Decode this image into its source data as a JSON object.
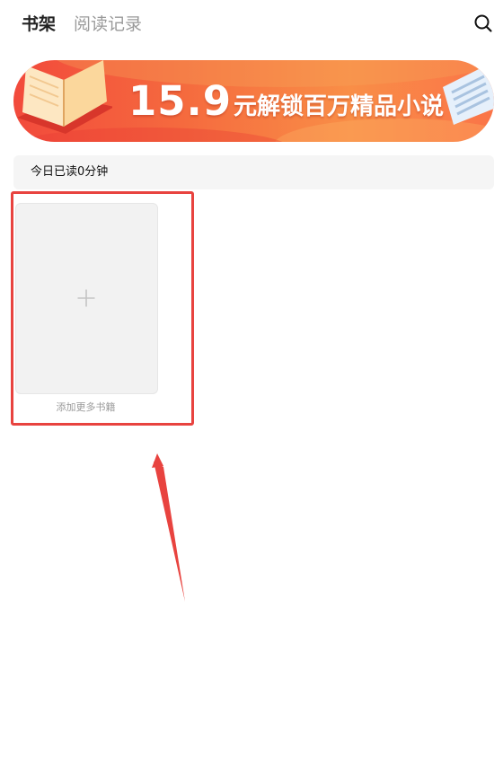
{
  "header": {
    "tabs": [
      {
        "label": "书架",
        "active": true
      },
      {
        "label": "阅读记录",
        "active": false
      }
    ],
    "search_icon": "search-icon"
  },
  "banner": {
    "price": "15.9",
    "text": "元解锁百万精品小说",
    "icons": [
      "open-book-icon",
      "newspaper-icon"
    ]
  },
  "reading_status": {
    "text": "今日已读0分钟"
  },
  "bookshelf": {
    "add_card": {
      "icon": "plus-icon",
      "label": "添加更多书籍"
    }
  },
  "annotation": {
    "color": "#e8433f",
    "type": "highlight-box-with-arrow"
  },
  "colors": {
    "accent": "#e8433f",
    "banner_start": "#f24a3c",
    "banner_end": "#fa7448",
    "inactive_text": "#9a9a9a"
  }
}
